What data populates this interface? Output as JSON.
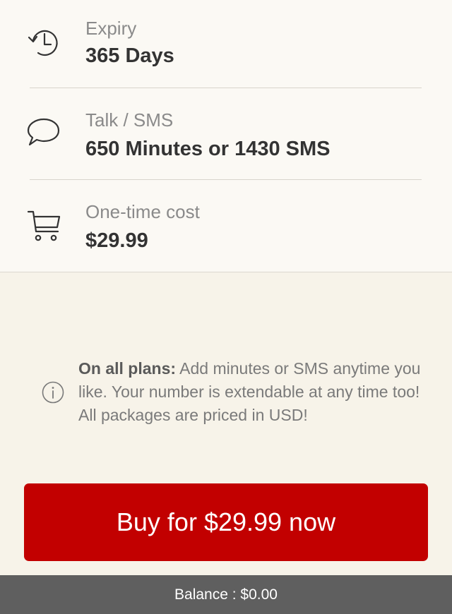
{
  "details": {
    "expiry": {
      "icon": "history-icon",
      "label": "Expiry",
      "value": "365 Days"
    },
    "talk_sms": {
      "icon": "speech-bubble-icon",
      "label": "Talk / SMS",
      "value": "650 Minutes or 1430 SMS"
    },
    "cost": {
      "icon": "cart-icon",
      "label": "One-time cost",
      "value": "$29.99"
    }
  },
  "info": {
    "icon": "info-icon",
    "lead": "On all plans:",
    "text": " Add minutes or SMS anytime you like. Your number is extendable at any time too! All packages are priced in USD!"
  },
  "buy_button": {
    "label": "Buy for $29.99 now"
  },
  "balance": {
    "text": "Balance : $0.00"
  },
  "colors": {
    "accent": "#c20000",
    "background": "#f7f3e9",
    "panel": "#fbf9f4",
    "footer": "#5f5f5f"
  }
}
